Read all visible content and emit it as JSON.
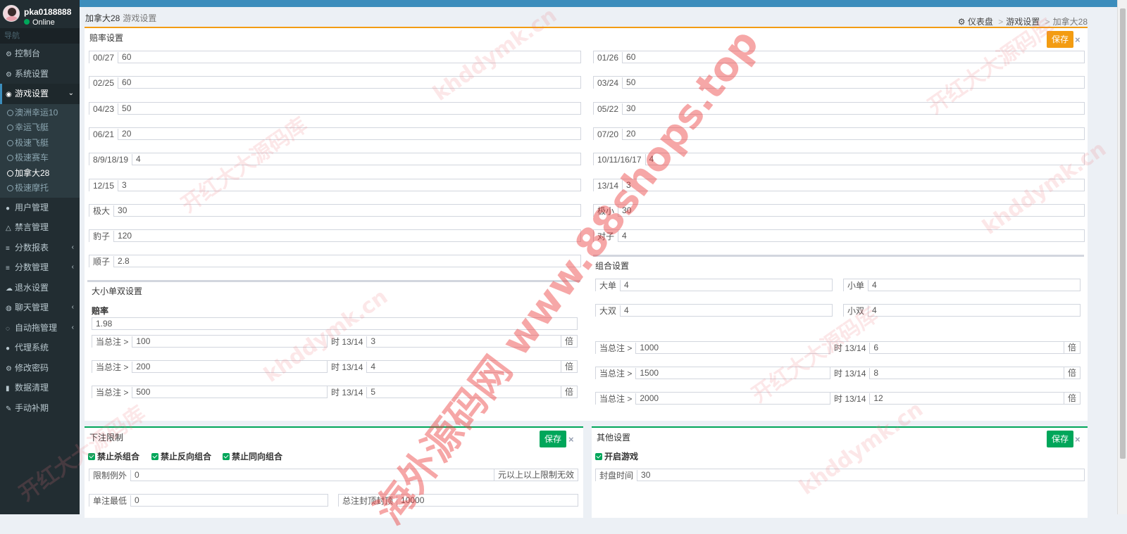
{
  "user": {
    "name": "pka0188888",
    "status": "Online"
  },
  "sidebar": {
    "header": "导航",
    "items": [
      {
        "label": "控制台",
        "icon": "dashboard-icon",
        "glyph": "⚙"
      },
      {
        "label": "系统设置",
        "icon": "cogs-icon",
        "glyph": "⚙"
      },
      {
        "label": "游戏设置",
        "icon": "gamepad-icon",
        "glyph": "◉",
        "active": true,
        "caret": "⌄"
      },
      {
        "label": "用户管理",
        "icon": "users-icon",
        "glyph": "●"
      },
      {
        "label": "禁言管理",
        "icon": "warning-icon",
        "glyph": "△"
      },
      {
        "label": "分数报表",
        "icon": "list-icon",
        "glyph": "≡",
        "caret": "‹"
      },
      {
        "label": "分数管理",
        "icon": "database-icon",
        "glyph": "≡",
        "caret": "‹"
      },
      {
        "label": "退水设置",
        "icon": "cloud-icon",
        "glyph": "☁"
      },
      {
        "label": "聊天管理",
        "icon": "comments-icon",
        "glyph": "◍",
        "caret": "‹"
      },
      {
        "label": "自动拖管理",
        "icon": "comment-icon",
        "glyph": "◌",
        "caret": "‹"
      },
      {
        "label": "代理系统",
        "icon": "user-group-icon",
        "glyph": "●"
      },
      {
        "label": "修改密码",
        "icon": "gear-icon",
        "glyph": "⚙"
      },
      {
        "label": "数据清理",
        "icon": "trash-icon",
        "glyph": "▮"
      },
      {
        "label": "手动补期",
        "icon": "wrench-icon",
        "glyph": "✎"
      }
    ],
    "submenu": [
      "澳洲幸运10",
      "幸运飞艇",
      "极速飞艇",
      "极速赛车",
      "加拿大28",
      "极速摩托"
    ],
    "submenu_active": 4
  },
  "header": {
    "title": "加拿大28",
    "subtitle": "游戏设置",
    "breadcrumb": [
      "仪表盘",
      "游戏设置",
      "加拿大28"
    ],
    "sep": ">"
  },
  "odds": {
    "title": "赔率设置",
    "save": "保存",
    "close": "×",
    "left": [
      {
        "label": "00/27",
        "value": "60"
      },
      {
        "label": "02/25",
        "value": "60"
      },
      {
        "label": "04/23",
        "value": "50"
      },
      {
        "label": "06/21",
        "value": "20"
      },
      {
        "label": "8/9/18/19",
        "value": "4"
      },
      {
        "label": "12/15",
        "value": "3"
      },
      {
        "label": "极大",
        "value": "30"
      },
      {
        "label": "豹子",
        "value": "120"
      },
      {
        "label": "顺子",
        "value": "2.8"
      }
    ],
    "right": [
      {
        "label": "01/26",
        "value": "60"
      },
      {
        "label": "03/24",
        "value": "50"
      },
      {
        "label": "05/22",
        "value": "30"
      },
      {
        "label": "07/20",
        "value": "20"
      },
      {
        "label": "10/11/16/17",
        "value": "4"
      },
      {
        "label": "13/14",
        "value": "3"
      },
      {
        "label": "极小",
        "value": "30"
      },
      {
        "label": "对子",
        "value": "4"
      }
    ]
  },
  "dxds": {
    "title": "大小单双设置",
    "rate_label": "赔率",
    "rate_value": "1.98",
    "rows": [
      {
        "label": "当总注 >",
        "amount": "100",
        "mid": "时 13/14",
        "mult": "3",
        "unit": "倍"
      },
      {
        "label": "当总注 >",
        "amount": "200",
        "mid": "时 13/14",
        "mult": "4",
        "unit": "倍"
      },
      {
        "label": "当总注 >",
        "amount": "500",
        "mid": "时 13/14",
        "mult": "5",
        "unit": "倍"
      }
    ]
  },
  "combo": {
    "title": "组合设置",
    "pairs": [
      {
        "label": "大单",
        "value": "4"
      },
      {
        "label": "小单",
        "value": "4"
      },
      {
        "label": "大双",
        "value": "4"
      },
      {
        "label": "小双",
        "value": "4"
      }
    ],
    "rows": [
      {
        "label": "当总注 >",
        "amount": "1000",
        "mid": "时 13/14",
        "mult": "6",
        "unit": "倍"
      },
      {
        "label": "当总注 >",
        "amount": "1500",
        "mid": "时 13/14",
        "mult": "8",
        "unit": "倍"
      },
      {
        "label": "当总注 >",
        "amount": "2000",
        "mid": "时 13/14",
        "mult": "12",
        "unit": "倍"
      }
    ]
  },
  "bet_limit": {
    "title": "下注限制",
    "save": "保存",
    "close": "×",
    "checks": [
      "禁止杀组合",
      "禁止反向组合",
      "禁止同向组合"
    ],
    "exception_label": "限制例外",
    "exception_value": "0",
    "exception_suffix": "元以上以上限制无效",
    "min_label": "单注最低",
    "min_value": "0",
    "max_label": "总注封顶封顶",
    "max_value": "10000"
  },
  "other": {
    "title": "其他设置",
    "save": "保存",
    "close": "×",
    "enable": "开启游戏",
    "close_time_label": "封盘时间",
    "close_time_value": "30"
  },
  "watermarks": [
    "开红大大源码库",
    "khddymk.cn",
    "海外源码网 www.88shops.top"
  ]
}
